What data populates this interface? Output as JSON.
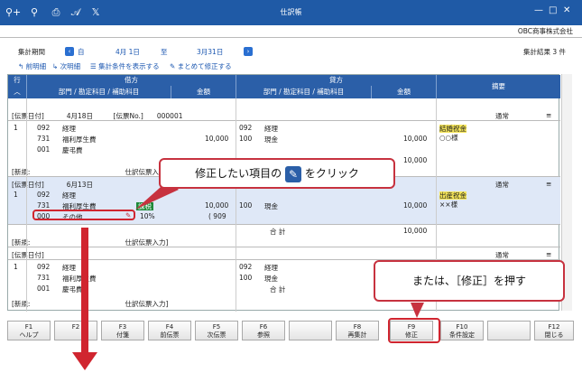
{
  "window": {
    "title": "仕訳帳",
    "company": "OBC商事株式会社"
  },
  "toolbar": {
    "icons": [
      "search-user-icon",
      "zoom-icon",
      "print-icon",
      "pdf-icon",
      "excel-icon"
    ],
    "extra": [
      "⚲+",
      "⚲",
      "⎙",
      "𝒜",
      "𝕏"
    ]
  },
  "period": {
    "label": "集計期間",
    "from_prefix": "自",
    "from_date": "4月 1日",
    "to_prefix": "至",
    "to_date": "3月31日",
    "count_label": "集計結果 3 件"
  },
  "links": {
    "prev": "前明細",
    "next": "次明細",
    "show_cond": "集計条件を表示する",
    "bulk_edit": "まとめて修正する"
  },
  "grid": {
    "row_label": "行",
    "debit": "借方",
    "credit": "貸方",
    "summary": "摘要",
    "dept_col": "部門 / 勘定科目 / 補助科目",
    "amount_col": "金額"
  },
  "entries": [
    {
      "header": "[伝票日付]　　　 4月18日　　　[伝票No.]　　000001",
      "type": "通常",
      "lines": [
        {
          "no": "1",
          "d_code": "092",
          "d_name": "経理",
          "c_code": "092",
          "c_name": "経理",
          "summary1": "結婚祝金",
          "summary2": "○○様"
        },
        {
          "no": "",
          "d_code": "731",
          "d_name": "福利厚生費",
          "d_amt": "10,000",
          "c_code": "100",
          "c_name": "現金",
          "c_amt": "10,000"
        },
        {
          "no": "",
          "d_code": "001",
          "d_name": "慶弔費"
        }
      ],
      "total": "10,000",
      "footer": "[新規:　　　　　　　　　　　　　　仕訳伝票入力]"
    },
    {
      "header": "[伝票日付]　　　 6月13日",
      "type": "通常",
      "lines": [
        {
          "no": "1",
          "d_code": "092",
          "d_name": "経理",
          "c_code": "092",
          "c_name": "経理",
          "summary1": "出産祝金",
          "summary2": "××様"
        },
        {
          "no": "",
          "d_code": "731",
          "d_name": "福利厚生費",
          "tag": "課税",
          "d_amt": "10,000",
          "c_code": "100",
          "c_name": "現金",
          "c_amt": "10,000"
        },
        {
          "no": "",
          "d_code": "000",
          "d_name": "その他",
          "rate": "10%",
          "d_amt2": "( 909"
        }
      ],
      "total_label": "合 計",
      "total": "10,000",
      "footer": "[新規:　　　　　　　　　　　　　　仕訳伝票入力]"
    },
    {
      "header": "[伝票日付]",
      "type": "通常",
      "lines": [
        {
          "no": "1",
          "d_code": "092",
          "d_name": "経理",
          "c_code": "092",
          "c_name": "経理"
        },
        {
          "no": "",
          "d_code": "731",
          "d_name": "福利厚生費",
          "c_code": "100",
          "c_name": "現金"
        },
        {
          "no": "",
          "d_code": "001",
          "d_name": "慶弔費"
        }
      ],
      "total_label": "合 計",
      "footer": "[新規:　　　　　　　　　　　　　　仕訳伝票入力]"
    }
  ],
  "fkeys": [
    {
      "key": "F1",
      "label": "ヘルプ"
    },
    {
      "key": "F2",
      "label": ""
    },
    {
      "key": "F3",
      "label": "付箋"
    },
    {
      "key": "F4",
      "label": "前伝票"
    },
    {
      "key": "F5",
      "label": "次伝票"
    },
    {
      "key": "F6",
      "label": "参照"
    },
    {
      "key": "",
      "label": ""
    },
    {
      "key": "F8",
      "label": "再集計"
    },
    {
      "key": "F9",
      "label": "修正"
    },
    {
      "key": "F10",
      "label": "条件設定"
    },
    {
      "key": "",
      "label": ""
    },
    {
      "key": "F12",
      "label": "閉じる"
    }
  ],
  "callouts": {
    "edit_item": "修正したい項目の",
    "edit_item_tail": "をクリック",
    "or_press": "または、［修正］を押す"
  },
  "colors": {
    "titlebar": "#1f5aa6",
    "header": "#2b5fa8",
    "highlight_red": "#d0252f",
    "selected_row": "#dfe8f7"
  }
}
